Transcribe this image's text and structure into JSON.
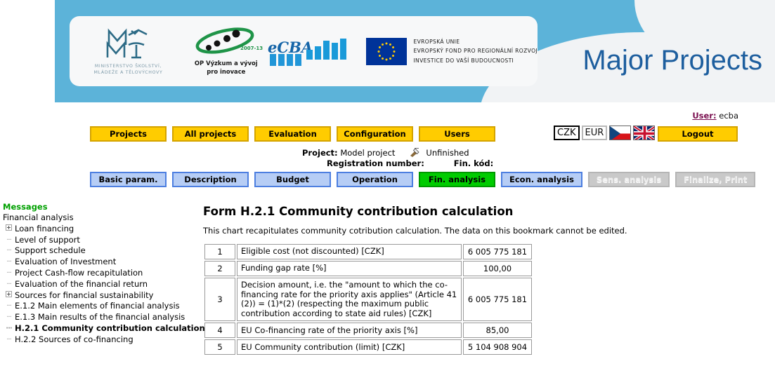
{
  "header": {
    "title": "Major Projects",
    "logos": {
      "msmt": {
        "mark": "MŠMT",
        "line1": "MINISTERSTVO ŠKOLSTVÍ,",
        "line2": "MLÁDEŽE A TĚLOVÝCHOVY"
      },
      "opvavpi": {
        "badge": "2007-13",
        "line1": "OP Výzkum a vývoj",
        "line2": "pro inovace"
      },
      "ecba": {
        "word": "eCBA"
      },
      "eu": {
        "line1": "EVROPSKÁ UNIE",
        "line2": "EVROPSKÝ FOND PRO REGIONÁLNÍ ROZVOJ",
        "line3": "INVESTICE DO VAŠÍ BUDOUCNOSTI"
      }
    }
  },
  "user": {
    "label": "User:",
    "name": "ecba"
  },
  "topnav": {
    "items": [
      {
        "label": "Projects"
      },
      {
        "label": "All projects"
      },
      {
        "label": "Evaluation"
      },
      {
        "label": "Configuration"
      },
      {
        "label": "Users"
      }
    ],
    "logout": "Logout"
  },
  "currency": {
    "czk": "CZK",
    "eur": "EUR",
    "selected": "CZK",
    "flags": [
      "cz-flag",
      "uk-flag"
    ]
  },
  "project": {
    "project_label": "Project:",
    "project_name": "Model project",
    "status_icon": "unfinished-tool-icon",
    "status": "Unfinished",
    "registration_label": "Registration number:",
    "registration_value": "",
    "fin_code_label": "Fin. kód:",
    "fin_code_value": ""
  },
  "tabs": [
    {
      "label": "Basic param.",
      "state": "normal"
    },
    {
      "label": "Description",
      "state": "normal"
    },
    {
      "label": "Budget",
      "state": "normal"
    },
    {
      "label": "Operation",
      "state": "normal"
    },
    {
      "label": "Fin. analysis",
      "state": "active"
    },
    {
      "label": "Econ. analysis",
      "state": "normal"
    },
    {
      "label": "Sens. analysis",
      "state": "disabled"
    },
    {
      "label": "Finalize, Print",
      "state": "disabled"
    }
  ],
  "sidebar": {
    "messages": "Messages",
    "root": "Financial analysis",
    "items": [
      {
        "label": "Loan financing",
        "expandable": true,
        "selected": false
      },
      {
        "label": "Level of support",
        "expandable": false,
        "selected": false
      },
      {
        "label": "Support schedule",
        "expandable": false,
        "selected": false
      },
      {
        "label": "Evaluation of Investment",
        "expandable": false,
        "selected": false
      },
      {
        "label": "Project Cash-flow recapitulation",
        "expandable": false,
        "selected": false
      },
      {
        "label": "Evaluation of the financial return",
        "expandable": false,
        "selected": false
      },
      {
        "label": "Sources for financial sustainability",
        "expandable": true,
        "selected": false
      },
      {
        "label": "E.1.2 Main elements of financial analysis",
        "expandable": false,
        "selected": false
      },
      {
        "label": "E.1.3 Main results of the financial analysis",
        "expandable": false,
        "selected": false
      },
      {
        "label": "H.2.1 Community contribution calculation",
        "expandable": false,
        "selected": true
      },
      {
        "label": "H.2.2 Sources of co-financing",
        "expandable": false,
        "selected": false
      }
    ]
  },
  "main": {
    "form_title": "Form H.2.1 Community contribution calculation",
    "form_desc": "This chart recapitulates community cotribution calculation. The data on this bookmark cannot be edited.",
    "table": {
      "rows": [
        {
          "num": "1",
          "label": "Eligible cost (not discounted) [CZK]",
          "value": "6 005 775 181"
        },
        {
          "num": "2",
          "label": "Funding gap rate [%]",
          "value": "100,00"
        },
        {
          "num": "3",
          "label": "Decision amount, i.e. the \"amount to which the co-financing rate for the priority axis applies\" (Article 41 (2)) = (1)*(2) (respecting the maximum public contribution according to state aid rules) [CZK]",
          "value": "6 005 775 181"
        },
        {
          "num": "4",
          "label": "EU Co-financing rate of the priority axis [%]",
          "value": "85,00"
        },
        {
          "num": "5",
          "label": "EU Community contribution (limit) [CZK]",
          "value": "5 104 908 904"
        }
      ]
    }
  },
  "colors": {
    "banner": "#5cb3d9",
    "title_blue": "#1d5e9e",
    "nav_yellow": "#ffcc00",
    "nav_yellow_border": "#d4a300",
    "tab_blue": "#b6cdf5",
    "tab_blue_border": "#4d7fe0",
    "tab_active_green": "#00cc00",
    "messages_green": "#00a000",
    "user_link": "#7a0f4f"
  }
}
